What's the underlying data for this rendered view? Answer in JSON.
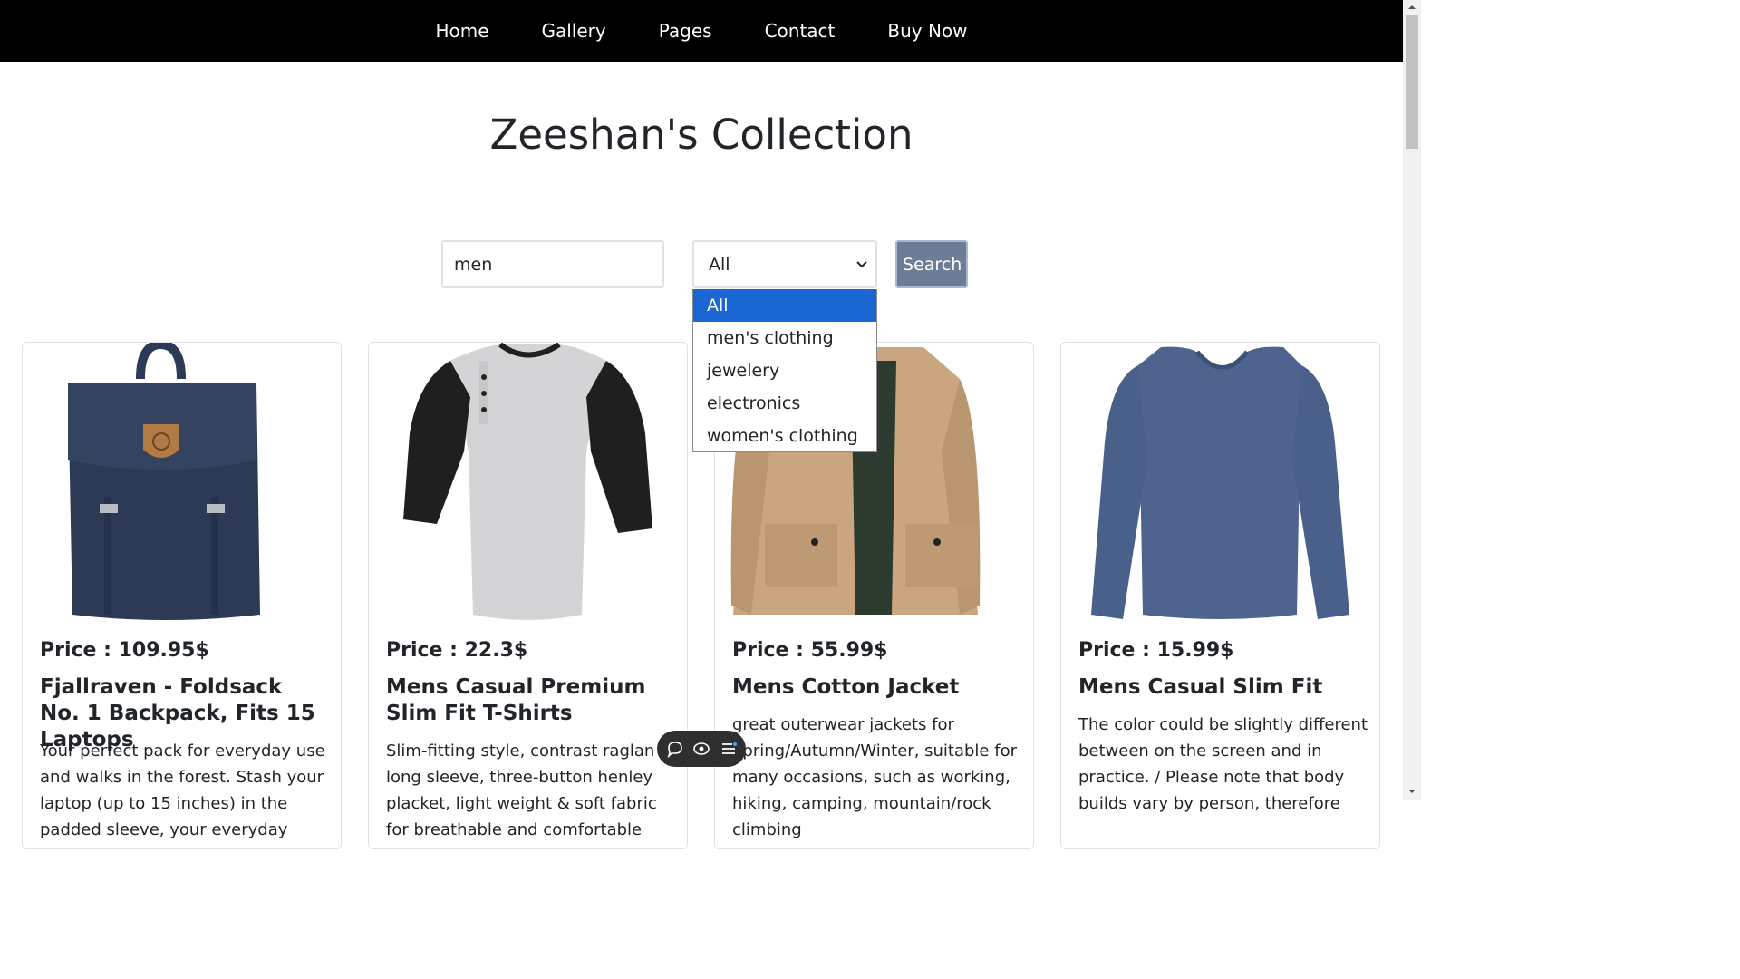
{
  "nav": {
    "items": [
      "Home",
      "Gallery",
      "Pages",
      "Contact",
      "Buy Now"
    ]
  },
  "page_title": "Zeeshan's Collection",
  "search": {
    "value": "men",
    "category_selected": "All",
    "category_options": [
      "All",
      "men's clothing",
      "jewelery",
      "electronics",
      "women's clothing"
    ],
    "button_label": "Search"
  },
  "products": [
    {
      "price": "Price : 109.95$",
      "title": "Fjallraven - Foldsack No. 1 Backpack, Fits 15 Laptops",
      "description": "Your perfect pack for everyday use and walks in the forest. Stash your laptop (up to 15 inches) in the padded sleeve, your everyday",
      "image": "navy-backpack"
    },
    {
      "price": "Price : 22.3$",
      "title": "Mens Casual Premium Slim Fit T-Shirts",
      "description": "Slim-fitting style, contrast raglan long sleeve, three-button henley placket, light weight & soft fabric for breathable and comfortable wearing.",
      "image": "raglan-henley-shirt"
    },
    {
      "price": "Price : 55.99$",
      "title": "Mens Cotton Jacket",
      "description": "great outerwear jackets for Spring/Autumn/Winter, suitable for many occasions, such as working, hiking, camping, mountain/rock climbing",
      "image": "khaki-cotton-jacket"
    },
    {
      "price": "Price : 15.99$",
      "title": "Mens Casual Slim Fit",
      "description": "The color could be slightly different between on the screen and in practice. / Please note that body builds vary by person, therefore",
      "image": "blue-long-sleeve-shirt"
    }
  ],
  "colors": {
    "nav_bg": "#000000",
    "search_button": "#6c7d96",
    "dropdown_selected": "#1a66d2"
  }
}
